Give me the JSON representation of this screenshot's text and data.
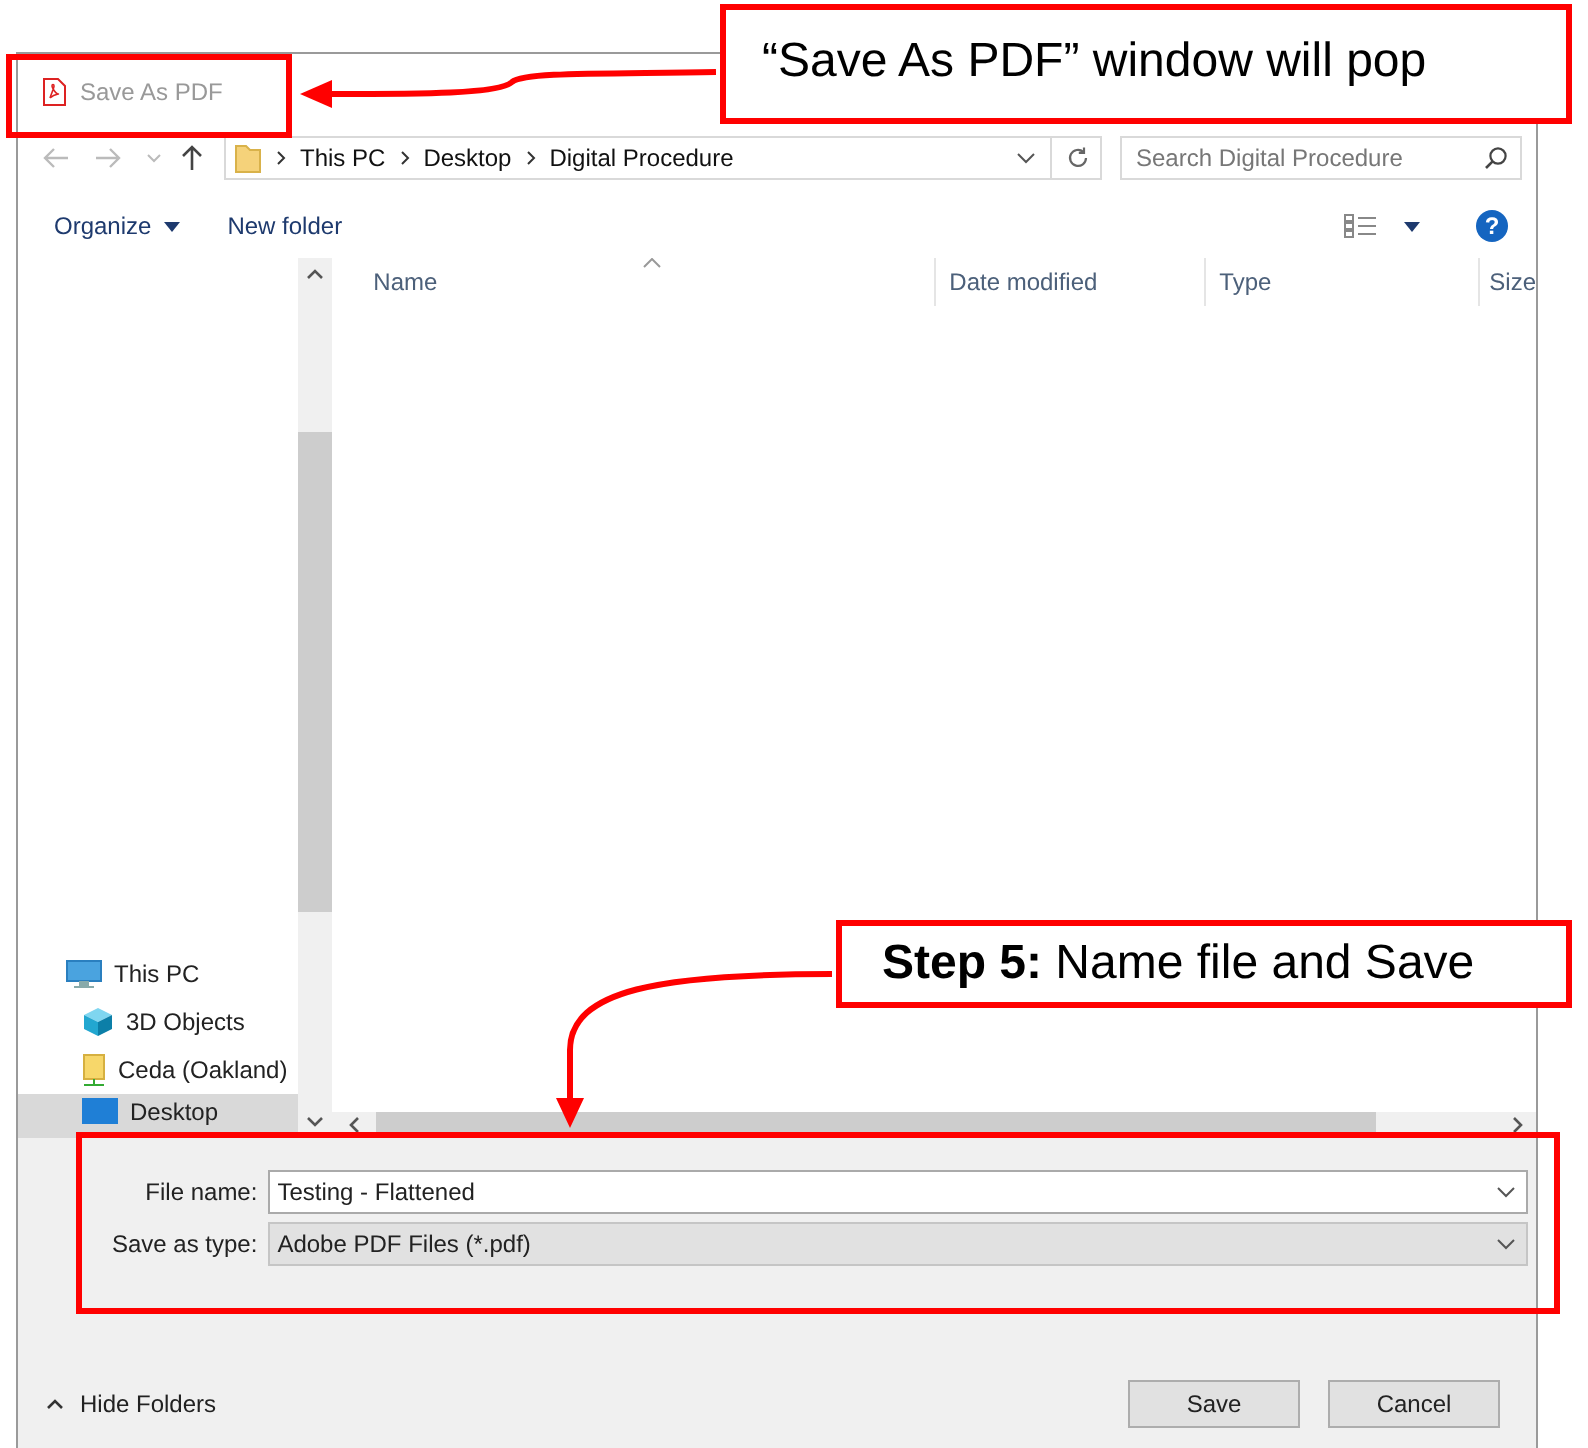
{
  "window": {
    "title": "Save As PDF"
  },
  "address_bar": {
    "path": [
      "This PC",
      "Desktop",
      "Digital Procedure"
    ]
  },
  "search": {
    "placeholder": "Search Digital Procedure"
  },
  "toolbar": {
    "organize": "Organize",
    "new_folder": "New folder",
    "help": "?"
  },
  "columns": [
    "Name",
    "Date modified",
    "Type",
    "Size"
  ],
  "nav_items": [
    {
      "label": "This PC",
      "kind": "computer",
      "selected": false,
      "child": false
    },
    {
      "label": "3D Objects",
      "kind": "cube",
      "selected": false,
      "child": true
    },
    {
      "label": "Ceda (Oakland)",
      "kind": "drive",
      "selected": false,
      "child": true
    },
    {
      "label": "Desktop",
      "kind": "desktop",
      "selected": true,
      "child": true
    }
  ],
  "file_name": {
    "label": "File name:",
    "value": "Testing - Flattened"
  },
  "save_type": {
    "label": "Save as type:",
    "value": "Adobe PDF Files (*.pdf)"
  },
  "hide_folders": "Hide Folders",
  "buttons": [
    "Save",
    "Cancel"
  ],
  "callouts": [
    {
      "kind": "top",
      "text": "“Save As PDF” window will pop"
    },
    {
      "kind": "step",
      "text": "**Step 5:** Name file and Save"
    }
  ]
}
